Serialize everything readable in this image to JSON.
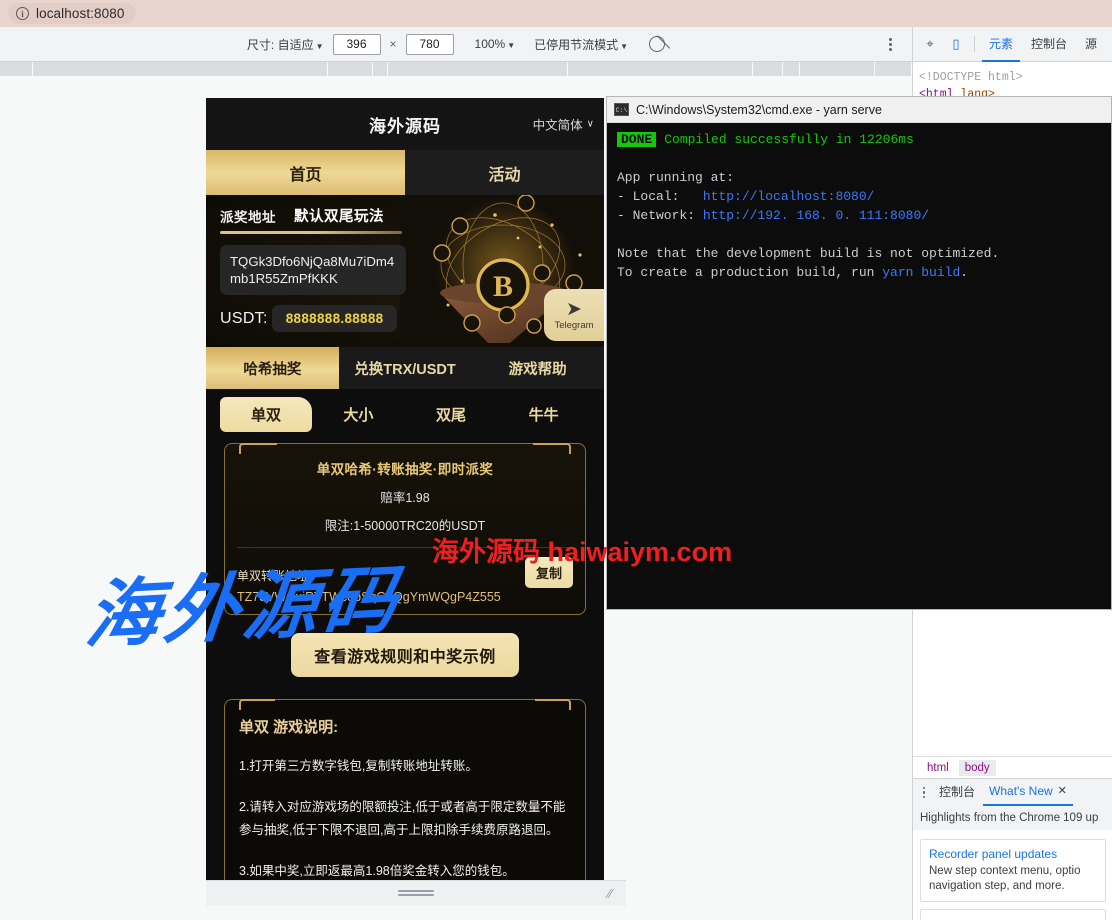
{
  "browser": {
    "url": "localhost:8080",
    "info_icon": "info-icon"
  },
  "device_toolbar": {
    "size_label": "尺寸: 自适应",
    "width_value": "396",
    "height_value": "780",
    "multiply": "×",
    "zoom_label": "100%",
    "throttle_label": "已停用节流模式",
    "throttle_icon": "no-throttling-icon",
    "more_icon": "more-options-icon",
    "caret": "▼"
  },
  "devtools": {
    "inspect_icon": "inspect-element-icon",
    "device_toggle_icon": "toggle-device-toolbar-icon",
    "tabs": [
      {
        "label": "元素",
        "active": true
      },
      {
        "label": "控制台",
        "active": false
      },
      {
        "label": "源",
        "active": false
      }
    ],
    "code_line1": "<!DOCTYPE html>",
    "code_line2_tag": "<html",
    "code_line2_attr": " lang>",
    "breadcrumb": [
      {
        "label": "html",
        "selected": false
      },
      {
        "label": "body",
        "selected": true
      }
    ],
    "drawer": {
      "more_icon": "drawer-more-icon",
      "tabs": [
        {
          "label": "控制台",
          "active": false
        },
        {
          "label": "What's New",
          "active": true
        }
      ],
      "close_icon": "✕",
      "headline": "Highlights from the Chrome 109 up",
      "cards": [
        {
          "title": "Recorder panel updates",
          "desc": "New step context menu, optio navigation step, and more."
        }
      ]
    }
  },
  "terminal": {
    "icon": "cmd-icon",
    "title": "C:\\Windows\\System32\\cmd.exe - yarn  serve",
    "done_badge": "DONE",
    "compiled": "Compiled successfully in 12206ms",
    "app_running": "App running at:",
    "local_label": "- Local:   ",
    "local_url": "http://localhost:8080/",
    "network_label": "- Network: ",
    "network_url": "http://192. 168. 0. 111:8080/",
    "note_line1": "Note that the development build is not optimized.",
    "note_line2_pre": "To create a production build, run ",
    "note_line2_cmd": "yarn build",
    "note_line2_post": "."
  },
  "app": {
    "title": "海外源码",
    "language": "中文简体",
    "lang_caret": "∨",
    "main_tabs": [
      {
        "label": "首页",
        "active": true
      },
      {
        "label": "活动",
        "active": false
      }
    ],
    "banner": {
      "tab_payout": "派奖地址",
      "tab_mode": "默认双尾玩法",
      "address": "TQGk3Dfo6NjQa8Mu7iDm4mb1R55ZmPfKKK",
      "usdt_label": "USDT:",
      "usdt_value": "8888888.88888",
      "telegram_label": "Telegram",
      "telegram_icon": "telegram-paper-plane-icon"
    },
    "subnav": [
      {
        "label": "哈希抽奖",
        "active": true
      },
      {
        "label": "兑换TRX/USDT",
        "active": false
      },
      {
        "label": "游戏帮助",
        "active": false
      }
    ],
    "game_tabs": [
      {
        "label": "单双",
        "active": true
      },
      {
        "label": "大小",
        "active": false
      },
      {
        "label": "双尾",
        "active": false
      },
      {
        "label": "牛牛",
        "active": false
      }
    ],
    "game_card": {
      "title": "单双哈希·转账抽奖·即时派奖",
      "odds": "赔率1.98",
      "limit": "限注:1-50000TRC20的USDT",
      "addr_label": "单双转账地址",
      "addr_value": "TZ78VWCuiRTTWcobSqGhQgYmWQgP4Z555",
      "copy_label": "复制"
    },
    "rules_button": "查看游戏规则和中奖示例",
    "instructions": {
      "title": "单双 游戏说明:",
      "items": [
        "1.打开第三方数字钱包,复制转账地址转账。",
        "2.请转入对应游戏场的限额投注,低于或者高于限定数量不能参与抽奖,低于下限不退回,高于上限扣除手续费原路退回。",
        "3.如果中奖,立即返最高1.98倍奖金转入您的钱包。"
      ]
    }
  },
  "watermarks": {
    "blue": "海外源码",
    "red": "海外源码 haiwaiym.com"
  },
  "colors": {
    "gold": "#e9c978",
    "gold_bright": "#efd896",
    "dark": "#0d0d0d",
    "accent_blue": "#1a73e8",
    "terminal_green": "#16c60c",
    "watermark_red": "#f01f1f",
    "watermark_blue": "#1a6ef5"
  }
}
